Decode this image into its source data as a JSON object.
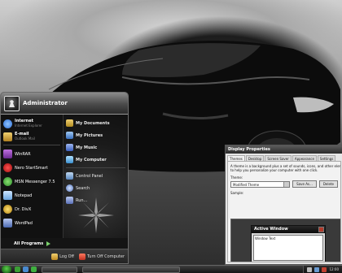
{
  "start_menu": {
    "user_name": "Administrator",
    "pinned": [
      {
        "name": "internet",
        "title": "Internet",
        "subtitle": "Internet Explorer",
        "color": "#2f6fd6"
      },
      {
        "name": "email",
        "title": "E-mail",
        "subtitle": "Outlook Mail",
        "color": "#d0a030"
      }
    ],
    "recent": [
      {
        "name": "winrar",
        "label": "WinRAR",
        "color": "#9b3fb5"
      },
      {
        "name": "nero",
        "label": "Nero StartSmart",
        "color": "#c82020"
      },
      {
        "name": "msn",
        "label": "MSN Messenger 7.5",
        "color": "#3aa23a"
      },
      {
        "name": "notepad",
        "label": "Notepad",
        "color": "#6aa5e0"
      },
      {
        "name": "drdivx",
        "label": "Dr. DivX",
        "color": "#e0b020"
      },
      {
        "name": "wordpad",
        "label": "WordPad",
        "color": "#6688cc"
      }
    ],
    "all_programs": "All Programs",
    "places": [
      {
        "name": "my-documents",
        "label": "My Documents",
        "color": "#d8b040"
      },
      {
        "name": "my-pictures",
        "label": "My Pictures",
        "color": "#5a90d0"
      },
      {
        "name": "my-music",
        "label": "My Music",
        "color": "#4a7fd0"
      },
      {
        "name": "my-computer",
        "label": "My Computer",
        "color": "#4aa0e0"
      }
    ],
    "system": [
      {
        "name": "control-panel",
        "label": "Control Panel",
        "color": "#6aa0d0"
      },
      {
        "name": "search",
        "label": "Search",
        "color": "#7a9ad0"
      },
      {
        "name": "run",
        "label": "Run...",
        "color": "#6a80c0"
      }
    ],
    "log_off": "Log Off",
    "turn_off": "Turn Off Computer"
  },
  "dialog": {
    "title": "Display Properties",
    "tabs": [
      "Themes",
      "Desktop",
      "Screen Saver",
      "Appearance",
      "Settings"
    ],
    "description_lines": [
      "A theme is a background plus a set of sounds, icons, and other eleme",
      "to help you personalize your computer with one click."
    ],
    "theme_label": "Theme:",
    "theme_value": "Modified Theme",
    "save_as": "Save As...",
    "delete": "Delete",
    "sample_label": "Sample:",
    "sample_window_title": "Active Window",
    "sample_window_text": "Window Text"
  },
  "taskbar": {
    "accent": "#3fae35",
    "quick_launch": [
      {
        "name": "ql-1",
        "color": "#3b9e35"
      },
      {
        "name": "ql-2",
        "color": "#4a8ad0"
      },
      {
        "name": "ql-3",
        "color": "#3fb040"
      }
    ],
    "tasks": [
      "",
      ""
    ],
    "clock": "12:00"
  }
}
